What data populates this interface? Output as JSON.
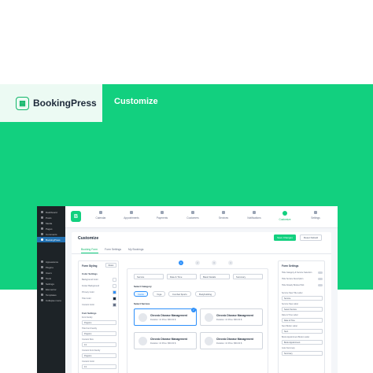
{
  "brand": {
    "name": "BookingPress",
    "heading": "Customize"
  },
  "colors": {
    "accent": "#12d07f",
    "selection": "#2e90fa"
  },
  "wp_sidebar": {
    "items": [
      "Dashboard",
      "Posts",
      "Media",
      "Pages",
      "Comments",
      "BookingPress",
      "",
      "",
      "",
      "Appearance",
      "Plugins",
      "Users",
      "Tools",
      "Settings",
      "Elementor",
      "Templates",
      "Collapse menu"
    ],
    "active_index": 5
  },
  "nav": {
    "items": [
      "Calendar",
      "Appointments",
      "Payments",
      "Customers",
      "Services",
      "Notifications",
      "Customize",
      "Settings"
    ],
    "active_index": 6
  },
  "content": {
    "title": "Customize",
    "save_label": "Save Changes",
    "reset_label": "Reset Default",
    "tabs": [
      "Booking Form",
      "Form Settings",
      "My Bookings"
    ],
    "active_tab": 0
  },
  "form_styling": {
    "title": "Form Styling",
    "reset": "Reset",
    "color_settings_title": "Color Settings",
    "colors": [
      {
        "label": "Background Color",
        "swatch": "#ffffff"
      },
      {
        "label": "Footer Background",
        "swatch": "#ffffff"
      },
      {
        "label": "Primary Color",
        "swatch": "#2e90fa"
      },
      {
        "label": "Title Color",
        "swatch": "#1d2939"
      },
      {
        "label": "Content Color",
        "swatch": "#667085"
      }
    ],
    "font_settings_title": "Font Settings",
    "font_family_label": "Font Family",
    "font_family_value": "Poppins",
    "title_font_label": "Title Font Family",
    "title_font_value": "Poppins",
    "content_size_label": "Content Size",
    "content_size_value": "13",
    "content_font_label": "Content Font Family",
    "content_font_value": "Poppins",
    "content_color_label": "Content Color",
    "content_color_value": "13"
  },
  "preview": {
    "steps": [
      "1",
      "2",
      "3",
      "4"
    ],
    "active_step": 0,
    "filters": [
      "Service",
      "Date & Time",
      "Basic Details",
      "Summary"
    ],
    "category_label": "Select Category",
    "chips": [
      "Cardio",
      "Yoga",
      "Combat Sports",
      "Bodybuilding"
    ],
    "active_chip": 0,
    "service_label": "Select Service",
    "services": [
      {
        "name": "Chronic Disease Management",
        "meta": "Duration: 1h   Price: $50.00 $"
      },
      {
        "name": "Chronic Disease Management",
        "meta": "Duration: 1h   Price: $50.00 $"
      },
      {
        "name": "Chronic Disease Management",
        "meta": "Duration: 1h   Price: $50.00 $"
      },
      {
        "name": "Chronic Disease Management",
        "meta": "Duration: 1h   Price: $50.00 $"
      }
    ],
    "selected_service": 0
  },
  "form_settings": {
    "title": "Form Settings",
    "toggles": [
      "Hide Category & Service Selection",
      "Hide Service Description",
      "Hide Already Booked Slot"
    ],
    "fields": [
      {
        "label": "Service Step Title Label",
        "value": "Service"
      },
      {
        "label": "Service Step Label",
        "value": "Select Service"
      },
      {
        "label": "Date & Time Label",
        "value": "Date & Time"
      },
      {
        "label": "Next Button Label",
        "value": "Next"
      },
      {
        "label": "Book Appointment Button Label",
        "value": "Book Appointment"
      },
      {
        "label": "Goto Summary",
        "value": "Summary"
      }
    ]
  }
}
